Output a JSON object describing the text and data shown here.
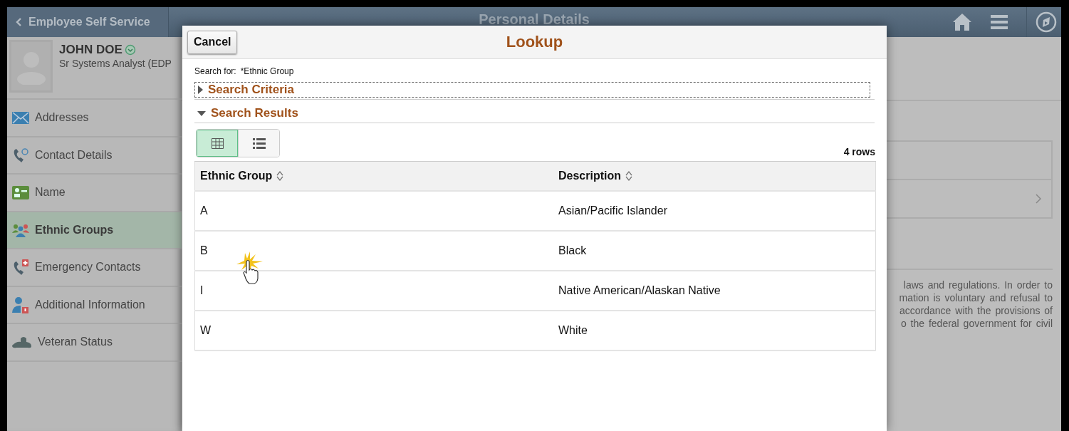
{
  "header": {
    "back_label": "Employee Self Service",
    "title": "Personal Details"
  },
  "profile": {
    "name": "JOHN DOE",
    "job_title": "Sr Systems Analyst (EDP"
  },
  "nav": [
    {
      "label": "Addresses",
      "selected": false
    },
    {
      "label": "Contact Details",
      "selected": false
    },
    {
      "label": "Name",
      "selected": false
    },
    {
      "label": "Ethnic Groups",
      "selected": true
    },
    {
      "label": "Emergency Contacts",
      "selected": false
    },
    {
      "label": "Additional Information",
      "selected": false
    },
    {
      "label": "Veteran Status",
      "selected": false
    }
  ],
  "background_text": [
    "laws and regulations. In order to",
    "mation is voluntary and refusal to",
    "accordance with the provisions of",
    "o the federal government for civil"
  ],
  "lookup": {
    "cancel": "Cancel",
    "title": "Lookup",
    "search_for_label": "Search for:",
    "search_for_value": "*Ethnic Group",
    "sections": [
      {
        "label": "Search Criteria",
        "expanded": false
      },
      {
        "label": "Search Results",
        "expanded": true
      }
    ],
    "views": [
      {
        "selected": true
      },
      {
        "selected": false
      }
    ],
    "row_count": "4 rows",
    "columns": [
      "Ethnic Group",
      "Description"
    ],
    "rows": [
      [
        "A",
        "Asian/Pacific Islander"
      ],
      [
        "B",
        "Black"
      ],
      [
        "I",
        "Native American/Alaskan Native"
      ],
      [
        "W",
        "White"
      ]
    ]
  }
}
